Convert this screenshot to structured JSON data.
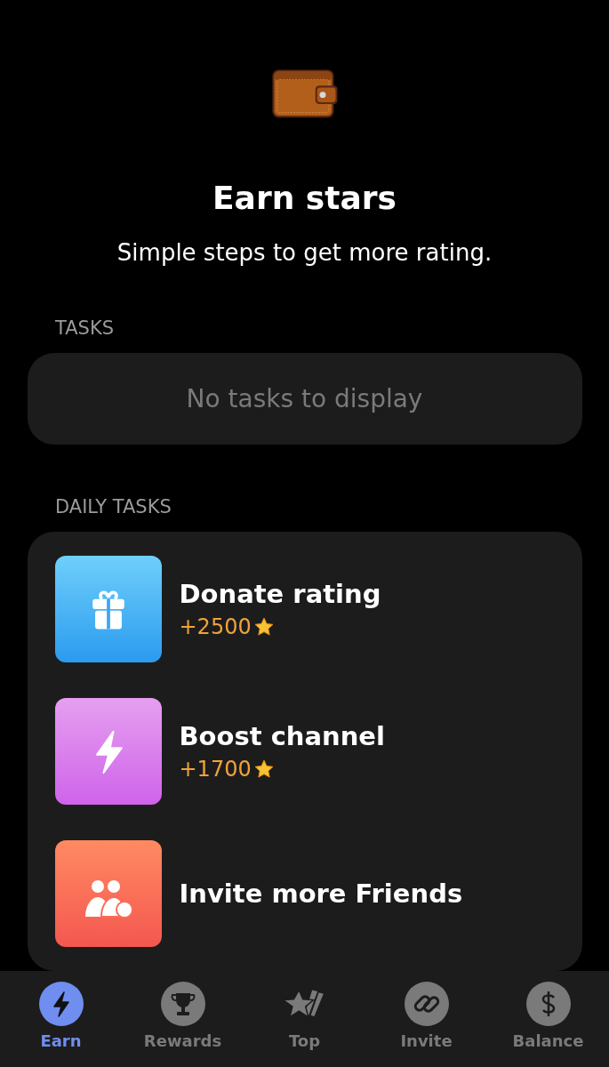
{
  "header": {
    "title": "Earn stars",
    "subtitle": "Simple steps to get more rating."
  },
  "tasks": {
    "label": "TASKS",
    "empty_text": "No tasks to display"
  },
  "daily_tasks": {
    "label": "DAILY TASKS",
    "items": [
      {
        "kind": "gift",
        "title": "Donate rating",
        "reward": "+2500"
      },
      {
        "kind": "bolt",
        "title": "Boost channel",
        "reward": "+1700"
      },
      {
        "kind": "friends",
        "title": "Invite more Friends"
      }
    ]
  },
  "nav": [
    {
      "kind": "bolt",
      "label": "Earn",
      "selected": true
    },
    {
      "kind": "trophy",
      "label": "Rewards",
      "selected": false
    },
    {
      "kind": "stars",
      "label": "Top",
      "selected": false
    },
    {
      "kind": "link",
      "label": "Invite",
      "selected": false
    },
    {
      "kind": "dollar",
      "label": "Balance",
      "selected": false
    }
  ]
}
